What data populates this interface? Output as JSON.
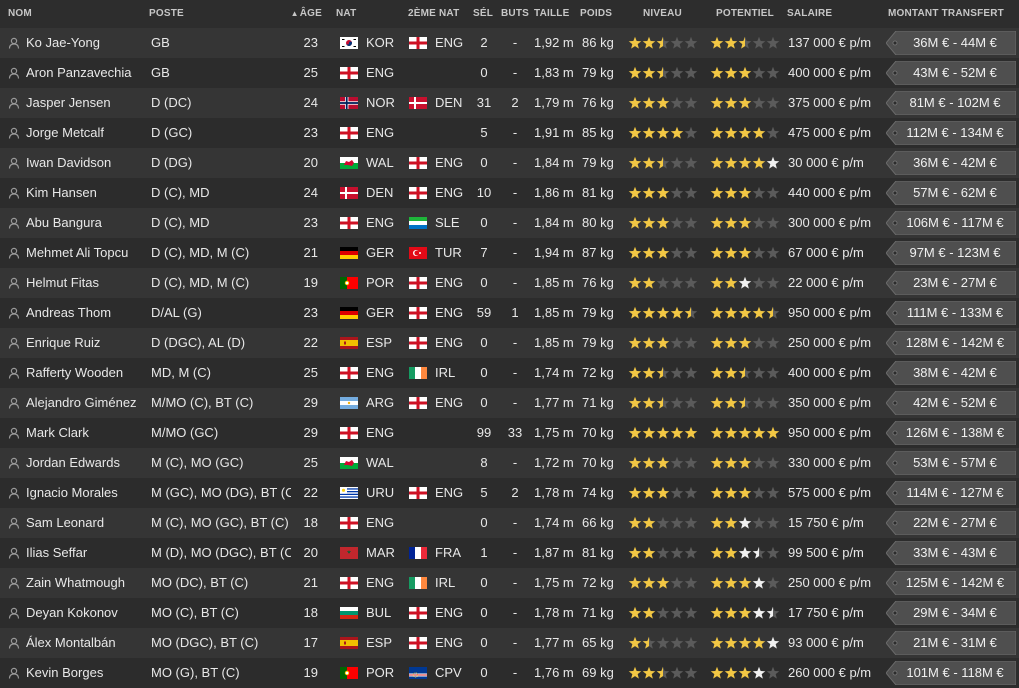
{
  "headers": {
    "nom": "NOM",
    "poste": "POSTE",
    "age": "ÂGE",
    "nat": "NAT",
    "nat2": "2ÈME NAT",
    "sel": "SÉL",
    "buts": "BUTS",
    "taille": "TAILLE",
    "poids": "POIDS",
    "niveau": "NIVEAU",
    "potentiel": "POTENTIEL",
    "salaire": "SALAIRE",
    "transfert": "MONTANT TRANSFERT"
  },
  "sort": {
    "column": "age",
    "icon": "sort-ascending-icon"
  },
  "colors": {
    "star_filled": "#f2c744",
    "star_empty": "#5b5b5b",
    "star_white": "#f0f0f0",
    "row_odd": "#353535",
    "row_even": "#2c2c2c",
    "transfer_tag": "#4f4f4f"
  },
  "icons": {
    "person": "person-icon",
    "star": "star-icon",
    "tag": "price-tag-icon"
  },
  "players": [
    {
      "nom": "Ko Jae-Yong",
      "poste": "GB",
      "age": "23",
      "nat": "KOR",
      "nat2": "ENG",
      "sel": "2",
      "buts": "-",
      "taille": "1,92 m",
      "poids": "86 kg",
      "niveau": 2.5,
      "potentiel": {
        "known": 2.5,
        "max": 2.5
      },
      "salaire": "137 000 € p/m",
      "transfert": "36M € - 44M €"
    },
    {
      "nom": "Aron Panzavechia",
      "poste": "GB",
      "age": "25",
      "nat": "ENG",
      "nat2": "",
      "sel": "0",
      "buts": "-",
      "taille": "1,83 m",
      "poids": "79 kg",
      "niveau": 2.5,
      "potentiel": {
        "known": 3,
        "max": 3
      },
      "salaire": "400 000 € p/m",
      "transfert": "43M € - 52M €"
    },
    {
      "nom": "Jasper Jensen",
      "poste": "D (DC)",
      "age": "24",
      "nat": "NOR",
      "nat2": "DEN",
      "sel": "31",
      "buts": "2",
      "taille": "1,79 m",
      "poids": "76 kg",
      "niveau": 3,
      "potentiel": {
        "known": 3,
        "max": 3
      },
      "salaire": "375 000 € p/m",
      "transfert": "81M € - 102M €"
    },
    {
      "nom": "Jorge Metcalf",
      "poste": "D (GC)",
      "age": "23",
      "nat": "ENG",
      "nat2": "",
      "sel": "5",
      "buts": "-",
      "taille": "1,91 m",
      "poids": "85 kg",
      "niveau": 4,
      "potentiel": {
        "known": 4,
        "max": 4
      },
      "salaire": "475 000 € p/m",
      "transfert": "112M € - 134M €"
    },
    {
      "nom": "Iwan Davidson",
      "poste": "D (DG)",
      "age": "20",
      "nat": "WAL",
      "nat2": "ENG",
      "sel": "0",
      "buts": "-",
      "taille": "1,84 m",
      "poids": "79 kg",
      "niveau": 2.5,
      "potentiel": {
        "known": 4,
        "max": 5
      },
      "salaire": "30 000 € p/m",
      "transfert": "36M € - 42M €"
    },
    {
      "nom": "Kim Hansen",
      "poste": "D (C), MD",
      "age": "24",
      "nat": "DEN",
      "nat2": "ENG",
      "sel": "10",
      "buts": "-",
      "taille": "1,86 m",
      "poids": "81 kg",
      "niveau": 3,
      "potentiel": {
        "known": 3,
        "max": 3
      },
      "salaire": "440 000 € p/m",
      "transfert": "57M € - 62M €"
    },
    {
      "nom": "Abu Bangura",
      "poste": "D (C), MD",
      "age": "23",
      "nat": "ENG",
      "nat2": "SLE",
      "sel": "0",
      "buts": "-",
      "taille": "1,84 m",
      "poids": "80 kg",
      "niveau": 3,
      "potentiel": {
        "known": 3,
        "max": 3
      },
      "salaire": "300 000 € p/m",
      "transfert": "106M € - 117M €"
    },
    {
      "nom": "Mehmet Ali Topcu",
      "poste": "D (C), MD, M (C)",
      "age": "21",
      "nat": "GER",
      "nat2": "TUR",
      "sel": "7",
      "buts": "-",
      "taille": "1,94 m",
      "poids": "87 kg",
      "niveau": 3,
      "potentiel": {
        "known": 3,
        "max": 3
      },
      "salaire": "67 000 € p/m",
      "transfert": "97M € - 123M €"
    },
    {
      "nom": "Helmut Fitas",
      "poste": "D (C), MD, M (C)",
      "age": "19",
      "nat": "POR",
      "nat2": "ENG",
      "sel": "0",
      "buts": "-",
      "taille": "1,85 m",
      "poids": "76 kg",
      "niveau": 2,
      "potentiel": {
        "known": 2,
        "max": 3
      },
      "salaire": "22 000 € p/m",
      "transfert": "23M € - 27M €"
    },
    {
      "nom": "Andreas Thom",
      "poste": "D/AL (G)",
      "age": "23",
      "nat": "GER",
      "nat2": "ENG",
      "sel": "59",
      "buts": "1",
      "taille": "1,85 m",
      "poids": "79 kg",
      "niveau": 4.5,
      "potentiel": {
        "known": 4.5,
        "max": 4.5
      },
      "salaire": "950 000 € p/m",
      "transfert": "111M € - 133M €"
    },
    {
      "nom": "Enrique Ruiz",
      "poste": "D (DGC), AL (D)",
      "age": "22",
      "nat": "ESP",
      "nat2": "ENG",
      "sel": "0",
      "buts": "-",
      "taille": "1,85 m",
      "poids": "79 kg",
      "niveau": 3,
      "potentiel": {
        "known": 3,
        "max": 3
      },
      "salaire": "250 000 € p/m",
      "transfert": "128M € - 142M €"
    },
    {
      "nom": "Rafferty Wooden",
      "poste": "MD, M (C)",
      "age": "25",
      "nat": "ENG",
      "nat2": "IRL",
      "sel": "0",
      "buts": "-",
      "taille": "1,74 m",
      "poids": "72 kg",
      "niveau": 2.5,
      "potentiel": {
        "known": 2.5,
        "max": 2.5
      },
      "salaire": "400 000 € p/m",
      "transfert": "38M € - 42M €"
    },
    {
      "nom": "Alejandro Giménez",
      "poste": "M/MO (C), BT (C)",
      "age": "29",
      "nat": "ARG",
      "nat2": "ENG",
      "sel": "0",
      "buts": "-",
      "taille": "1,77 m",
      "poids": "71 kg",
      "niveau": 2.5,
      "potentiel": {
        "known": 2.5,
        "max": 2.5
      },
      "salaire": "350 000 € p/m",
      "transfert": "42M € - 52M €"
    },
    {
      "nom": "Mark Clark",
      "poste": "M/MO (GC)",
      "age": "29",
      "nat": "ENG",
      "nat2": "",
      "sel": "99",
      "buts": "33",
      "taille": "1,75 m",
      "poids": "70 kg",
      "niveau": 5,
      "potentiel": {
        "known": 5,
        "max": 5
      },
      "salaire": "950 000 € p/m",
      "transfert": "126M € - 138M €"
    },
    {
      "nom": "Jordan Edwards",
      "poste": "M (C), MO (GC)",
      "age": "25",
      "nat": "WAL",
      "nat2": "",
      "sel": "8",
      "buts": "-",
      "taille": "1,72 m",
      "poids": "70 kg",
      "niveau": 3,
      "potentiel": {
        "known": 3,
        "max": 3
      },
      "salaire": "330 000 € p/m",
      "transfert": "53M € - 57M €"
    },
    {
      "nom": "Ignacio Morales",
      "poste": "M (GC), MO (DG), BT (C)",
      "age": "22",
      "nat": "URU",
      "nat2": "ENG",
      "sel": "5",
      "buts": "2",
      "taille": "1,78 m",
      "poids": "74 kg",
      "niveau": 3,
      "potentiel": {
        "known": 3,
        "max": 3
      },
      "salaire": "575 000 € p/m",
      "transfert": "114M € - 127M €"
    },
    {
      "nom": "Sam Leonard",
      "poste": "M (C), MO (GC), BT (C)",
      "age": "18",
      "nat": "ENG",
      "nat2": "",
      "sel": "0",
      "buts": "-",
      "taille": "1,74 m",
      "poids": "66 kg",
      "niveau": 2,
      "potentiel": {
        "known": 2,
        "max": 3
      },
      "salaire": "15 750 € p/m",
      "transfert": "22M € - 27M €"
    },
    {
      "nom": "Ilias Seffar",
      "poste": "M (D), MO (DGC), BT (C)",
      "age": "20",
      "nat": "MAR",
      "nat2": "FRA",
      "sel": "1",
      "buts": "-",
      "taille": "1,87 m",
      "poids": "81 kg",
      "niveau": 2,
      "potentiel": {
        "known": 2,
        "max": 3.5
      },
      "salaire": "99 500 € p/m",
      "transfert": "33M € - 43M €"
    },
    {
      "nom": "Zain Whatmough",
      "poste": "MO (DC), BT (C)",
      "age": "21",
      "nat": "ENG",
      "nat2": "IRL",
      "sel": "0",
      "buts": "-",
      "taille": "1,75 m",
      "poids": "72 kg",
      "niveau": 3,
      "potentiel": {
        "known": 3,
        "max": 4
      },
      "salaire": "250 000 € p/m",
      "transfert": "125M € - 142M €"
    },
    {
      "nom": "Deyan Kokonov",
      "poste": "MO (C), BT (C)",
      "age": "18",
      "nat": "BUL",
      "nat2": "ENG",
      "sel": "0",
      "buts": "-",
      "taille": "1,78 m",
      "poids": "71 kg",
      "niveau": 2,
      "potentiel": {
        "known": 3,
        "max": 4.5
      },
      "salaire": "17 750 € p/m",
      "transfert": "29M € - 34M €"
    },
    {
      "nom": "Álex Montalbán",
      "poste": "MO (DGC), BT (C)",
      "age": "17",
      "nat": "ESP",
      "nat2": "ENG",
      "sel": "0",
      "buts": "-",
      "taille": "1,77 m",
      "poids": "65 kg",
      "niveau": 1.5,
      "potentiel": {
        "known": 4,
        "max": 5
      },
      "salaire": "93 000 € p/m",
      "transfert": "21M € - 31M €"
    },
    {
      "nom": "Kevin Borges",
      "poste": "MO (G), BT (C)",
      "age": "19",
      "nat": "POR",
      "nat2": "CPV",
      "sel": "0",
      "buts": "-",
      "taille": "1,76 m",
      "poids": "69 kg",
      "niveau": 2.5,
      "potentiel": {
        "known": 3,
        "max": 4
      },
      "salaire": "260 000 € p/m",
      "transfert": "101M € - 118M €"
    }
  ]
}
